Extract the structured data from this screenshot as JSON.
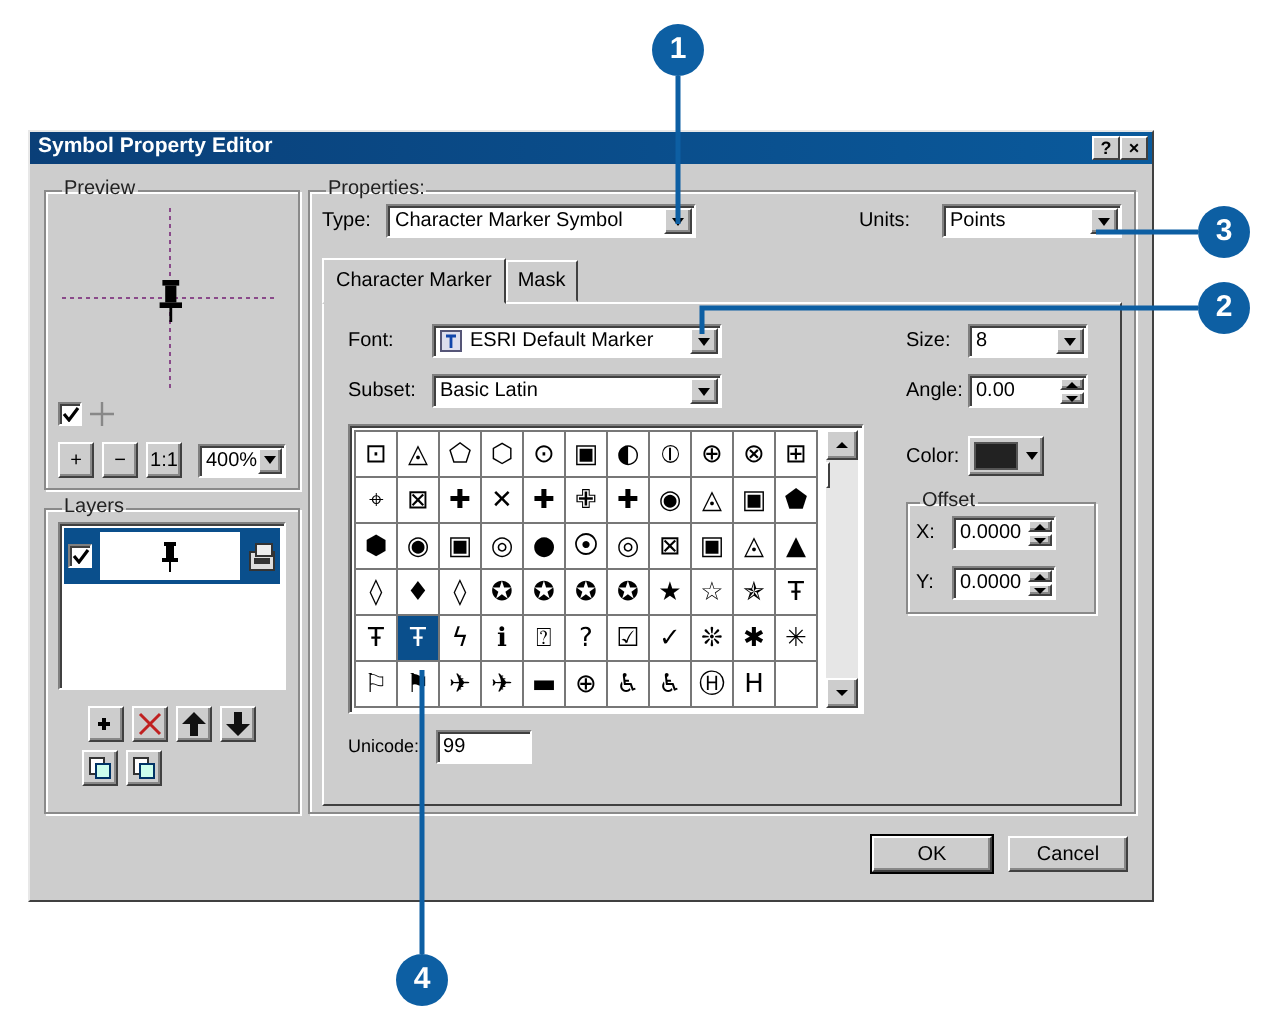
{
  "window": {
    "title": "Symbol Property Editor",
    "buttons": [
      "?",
      "×"
    ]
  },
  "preview": {
    "label": "Preview",
    "crosshair_checked": true,
    "buttons": [
      "+",
      "−",
      "1:1"
    ],
    "zoom": "400%"
  },
  "layers": {
    "label": "Layers",
    "rows": [
      {
        "checked": true,
        "selected": true
      }
    ]
  },
  "properties": {
    "label": "Properties:",
    "type_label": "Type:",
    "type_value": "Character Marker Symbol",
    "units_label": "Units:",
    "units_value": "Points"
  },
  "tabs": [
    {
      "label": "Character Marker",
      "selected": true
    },
    {
      "label": "Mask",
      "selected": false
    }
  ],
  "character_marker": {
    "font_label": "Font:",
    "font_value": "ESRI Default Marker",
    "subset_label": "Subset:",
    "subset_value": "Basic Latin",
    "size_label": "Size:",
    "size_value": "8",
    "angle_label": "Angle:",
    "angle_value": "0.00",
    "color_label": "Color:",
    "offset": {
      "label": "Offset",
      "x_label": "X:",
      "x_value": "0.0000",
      "y_label": "Y:",
      "y_value": "0.0000"
    },
    "symbols": [
      [
        {
          "glyph": "⊡",
          "selected": false
        },
        {
          "glyph": "◬",
          "selected": false
        },
        {
          "glyph": "⬠",
          "selected": false
        },
        {
          "glyph": "⬡",
          "selected": false
        },
        {
          "glyph": "⊙",
          "selected": false
        },
        {
          "glyph": "▣",
          "selected": false
        },
        {
          "glyph": "◐",
          "selected": false
        },
        {
          "glyph": "⦶",
          "selected": false
        },
        {
          "glyph": "⊕",
          "selected": false
        },
        {
          "glyph": "⊗",
          "selected": false
        },
        {
          "glyph": "⊞",
          "selected": false
        }
      ],
      [
        {
          "glyph": "⌖",
          "selected": false
        },
        {
          "glyph": "⊠",
          "selected": false
        },
        {
          "glyph": "✚",
          "selected": false
        },
        {
          "glyph": "✕",
          "selected": false
        },
        {
          "glyph": "✚",
          "selected": false
        },
        {
          "glyph": "✙",
          "selected": false
        },
        {
          "glyph": "✚",
          "selected": false
        },
        {
          "glyph": "◉",
          "selected": false
        },
        {
          "glyph": "◬",
          "selected": false
        },
        {
          "glyph": "▣",
          "selected": false
        },
        {
          "glyph": "⬟",
          "selected": false
        }
      ],
      [
        {
          "glyph": "⬢",
          "selected": false
        },
        {
          "glyph": "◉",
          "selected": false
        },
        {
          "glyph": "▣",
          "selected": false
        },
        {
          "glyph": "◎",
          "selected": false
        },
        {
          "glyph": "●",
          "selected": false
        },
        {
          "glyph": "⦿",
          "selected": false
        },
        {
          "glyph": "◎",
          "selected": false
        },
        {
          "glyph": "⊠",
          "selected": false
        },
        {
          "glyph": "▣",
          "selected": false
        },
        {
          "glyph": "◬",
          "selected": false
        },
        {
          "glyph": "▲",
          "selected": false
        }
      ],
      [
        {
          "glyph": "◊",
          "selected": false
        },
        {
          "glyph": "♦",
          "selected": false
        },
        {
          "glyph": "◊",
          "selected": false
        },
        {
          "glyph": "✪",
          "selected": false
        },
        {
          "glyph": "✪",
          "selected": false
        },
        {
          "glyph": "✪",
          "selected": false
        },
        {
          "glyph": "✪",
          "selected": false
        },
        {
          "glyph": "★",
          "selected": false
        },
        {
          "glyph": "☆",
          "selected": false
        },
        {
          "glyph": "✯",
          "selected": false
        },
        {
          "glyph": "Ŧ",
          "selected": false
        }
      ],
      [
        {
          "glyph": "Ŧ",
          "selected": false
        },
        {
          "glyph": "Ŧ",
          "selected": true
        },
        {
          "glyph": "ϟ",
          "selected": false
        },
        {
          "glyph": "ℹ",
          "selected": false
        },
        {
          "glyph": "⍰",
          "selected": false
        },
        {
          "glyph": "?",
          "selected": false
        },
        {
          "glyph": "☑",
          "selected": false
        },
        {
          "glyph": "✓",
          "selected": false
        },
        {
          "glyph": "❊",
          "selected": false
        },
        {
          "glyph": "✱",
          "selected": false
        },
        {
          "glyph": "✳",
          "selected": false
        }
      ],
      [
        {
          "glyph": "⚐",
          "selected": false
        },
        {
          "glyph": "⚑",
          "selected": false
        },
        {
          "glyph": "✈",
          "selected": false
        },
        {
          "glyph": "✈",
          "selected": false
        },
        {
          "glyph": "▬",
          "selected": false
        },
        {
          "glyph": "⊕",
          "selected": false
        },
        {
          "glyph": "♿",
          "selected": false
        },
        {
          "glyph": "♿",
          "selected": false
        },
        {
          "glyph": "Ⓗ",
          "selected": false
        },
        {
          "glyph": "H",
          "selected": false
        },
        {
          "selected": false
        }
      ]
    ],
    "unicode_label": "Unicode:",
    "unicode_value": "99"
  },
  "buttons": [
    "OK",
    "Cancel"
  ],
  "callouts": [
    "1",
    "2",
    "3",
    "4"
  ]
}
